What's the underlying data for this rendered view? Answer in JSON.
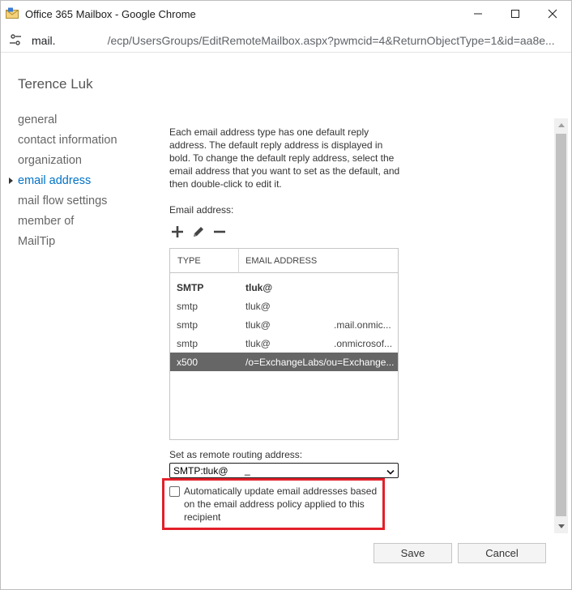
{
  "window": {
    "title": "Office 365 Mailbox - Google Chrome",
    "icon": "mailbox-envelope-icon"
  },
  "address_bar": {
    "host": "mail.",
    "path": "/ecp/UsersGroups/EditRemoteMailbox.aspx?pwmcid=4&ReturnObjectType=1&id=aa8e..."
  },
  "person": {
    "name": "Terence Luk"
  },
  "nav": {
    "items": [
      {
        "label": "general"
      },
      {
        "label": "contact information"
      },
      {
        "label": "organization"
      },
      {
        "label": "email address",
        "active": true
      },
      {
        "label": "mail flow settings"
      },
      {
        "label": "member of"
      },
      {
        "label": "MailTip"
      }
    ]
  },
  "email_section": {
    "description": "Each email address type has one default reply address. The default reply address is displayed in bold. To change the default reply address, select the email address that you want to set as the default, and then double-click to edit it.",
    "label": "Email address:",
    "toolbar": [
      "add-icon",
      "edit-pencil-icon",
      "remove-icon"
    ],
    "columns": {
      "type": "TYPE",
      "email": "EMAIL ADDRESS"
    },
    "rows": [
      {
        "type": "SMTP",
        "email": "tluk@",
        "domain": "",
        "bold": true
      },
      {
        "type": "smtp",
        "email": "tluk@",
        "domain": ""
      },
      {
        "type": "smtp",
        "email": "tluk@",
        "domain": ".mail.onmic..."
      },
      {
        "type": "smtp",
        "email": "tluk@",
        "domain": ".onmicrosof..."
      },
      {
        "type": "x500",
        "email": "/o=ExchangeLabs/ou=Exchange...",
        "domain": "",
        "selected": true
      }
    ]
  },
  "routing": {
    "label": "Set as remote routing address:",
    "selected": "SMTP:tluk@",
    "extra": "_"
  },
  "auto_update": {
    "label": "Automatically update email addresses based on the email address policy applied to this recipient",
    "checked": false
  },
  "buttons": {
    "save": "Save",
    "cancel": "Cancel"
  },
  "colors": {
    "accent": "#0072c6",
    "selected_row": "#666666",
    "highlight": "#e3202a"
  }
}
